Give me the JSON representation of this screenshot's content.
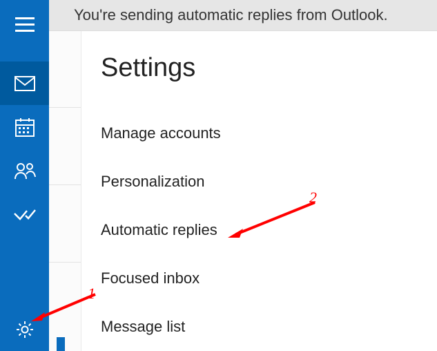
{
  "notification": {
    "text": "You're sending automatic replies from Outlook."
  },
  "settings": {
    "title": "Settings",
    "items": [
      {
        "label": "Manage accounts"
      },
      {
        "label": "Personalization"
      },
      {
        "label": "Automatic replies"
      },
      {
        "label": "Focused inbox"
      },
      {
        "label": "Message list"
      }
    ]
  },
  "rail": {
    "icons": {
      "hamburger": "hamburger-icon",
      "mail": "mail-icon",
      "calendar": "calendar-icon",
      "people": "people-icon",
      "todo": "todo-icon",
      "settings": "gear-icon"
    }
  },
  "annotations": {
    "one": "1",
    "two": "2"
  }
}
